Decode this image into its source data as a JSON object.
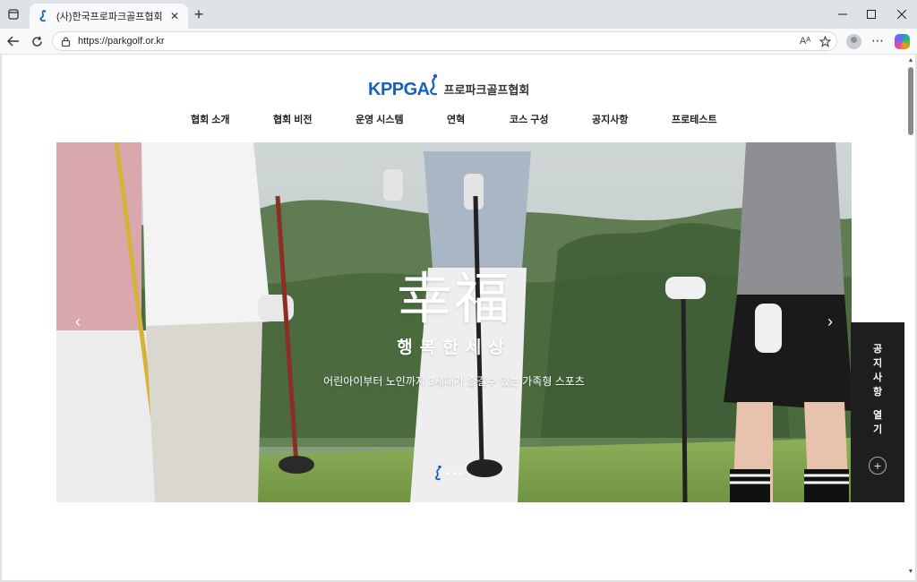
{
  "browser": {
    "tab_title": "(사)한국프로파크골프협회",
    "url": "https://parkgolf.or.kr",
    "new_tab_symbol": "+",
    "close_tab_symbol": "✕",
    "icons": {
      "tab_actions": "tab-actions-icon",
      "favicon": "kppga-favicon-icon",
      "back": "back-arrow-icon",
      "refresh": "refresh-icon",
      "lock": "site-info-icon",
      "read_aloud": "read-aloud-icon",
      "favorite": "star-icon",
      "profile": "profile-avatar-icon",
      "more": "more-menu-icon",
      "copilot": "copilot-icon",
      "minimize": "minimize-icon",
      "maximize": "maximize-icon",
      "close": "close-window-icon"
    },
    "read_aloud_label": "Aᴬ"
  },
  "site": {
    "logo_en": "KPPGA",
    "logo_ko": "프로파크골프협회",
    "brand_color": "#1662b8",
    "nav": [
      {
        "label": "협회 소개"
      },
      {
        "label": "협회 비전"
      },
      {
        "label": "운영 시스템"
      },
      {
        "label": "연혁"
      },
      {
        "label": "코스 구성"
      },
      {
        "label": "공지사항"
      },
      {
        "label": "프로테스트"
      }
    ]
  },
  "hero": {
    "hanja": "幸福",
    "subtitle": "행복한세상",
    "description": "어린아이부터 노인까지 3세대가 즐길수 있는 가족형 스포츠",
    "prev_symbol": "‹",
    "next_symbol": "›"
  },
  "notice_panel": {
    "label_lines": [
      "공",
      "지",
      "사",
      "항",
      "",
      "열",
      "기"
    ],
    "plus_symbol": "+"
  }
}
